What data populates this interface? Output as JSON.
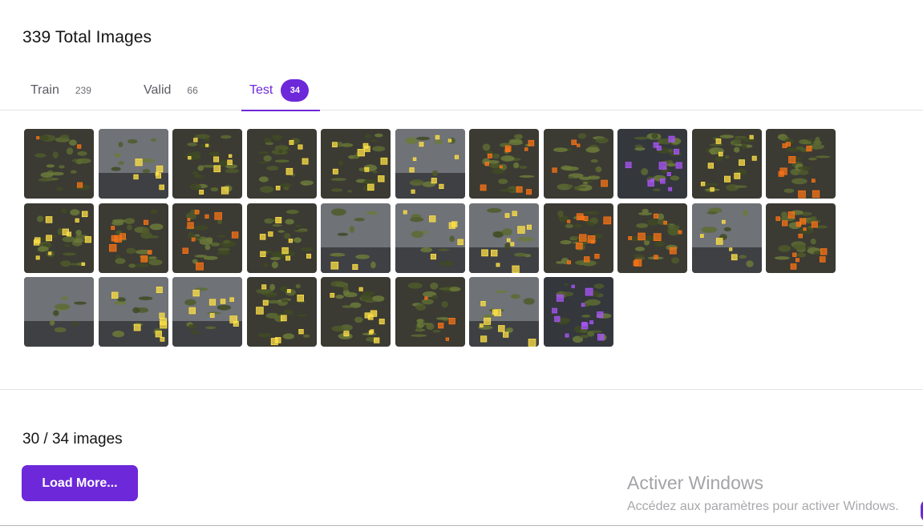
{
  "header": {
    "title": "339 Total Images"
  },
  "tabs": [
    {
      "label": "Train",
      "count": "239"
    },
    {
      "label": "Valid",
      "count": "66"
    },
    {
      "label": "Test",
      "count": "34"
    }
  ],
  "thumb_rows": [
    [
      {
        "kind": "plant",
        "box": "#f97316",
        "n": 3
      },
      {
        "kind": "room",
        "box": "#fde047",
        "n": 6
      },
      {
        "kind": "plant",
        "box": "#fde047",
        "n": 9
      },
      {
        "kind": "plant",
        "box": "#fde047",
        "n": 5
      },
      {
        "kind": "plant",
        "box": "#fde047",
        "n": 9
      },
      {
        "kind": "room",
        "box": "#fde047",
        "n": 9
      },
      {
        "kind": "plant",
        "box": "#f97316",
        "n": 10
      },
      {
        "kind": "plant",
        "box": "#f97316",
        "n": 4
      },
      {
        "kind": "dark",
        "box": "#a855f7",
        "n": 12
      },
      {
        "kind": "plant",
        "box": "#fde047",
        "n": 10
      },
      {
        "kind": "plant",
        "box": "#f97316",
        "n": 9
      }
    ],
    [
      {
        "kind": "plant",
        "box": "#fde047",
        "n": 12
      },
      {
        "kind": "plant",
        "box": "#f97316",
        "n": 8
      },
      {
        "kind": "plant",
        "box": "#f97316",
        "n": 9
      },
      {
        "kind": "plant",
        "box": "#fde047",
        "n": 8
      },
      {
        "kind": "room",
        "box": "#fde047",
        "n": 2
      },
      {
        "kind": "room",
        "box": "#fde047",
        "n": 6
      },
      {
        "kind": "room",
        "box": "#fde047",
        "n": 10
      },
      {
        "kind": "plant",
        "box": "#f97316",
        "n": 12
      },
      {
        "kind": "plant",
        "box": "#f97316",
        "n": 10
      },
      {
        "kind": "room",
        "box": "#fde047",
        "n": 5
      },
      {
        "kind": "plant",
        "box": "#f97316",
        "n": 13
      }
    ],
    [
      {
        "kind": "room",
        "box": "#fde047",
        "n": 0
      },
      {
        "kind": "room",
        "box": "#fde047",
        "n": 8
      },
      {
        "kind": "room",
        "box": "#fde047",
        "n": 8
      },
      {
        "kind": "plant",
        "box": "#fde047",
        "n": 9
      },
      {
        "kind": "plant",
        "box": "#fde047",
        "n": 10
      },
      {
        "kind": "plant",
        "box": "#f97316",
        "n": 4
      },
      {
        "kind": "room",
        "box": "#fde047",
        "n": 9
      },
      {
        "kind": "dark",
        "box": "#a855f7",
        "n": 12
      }
    ]
  ],
  "footer": {
    "progress": "30 / 34 images",
    "load_more_label": "Load More..."
  },
  "watermark": {
    "title": "Activer Windows",
    "subtitle": "Accédez aux paramètres pour activer Windows."
  },
  "colors": {
    "accent": "#6d28d9"
  }
}
